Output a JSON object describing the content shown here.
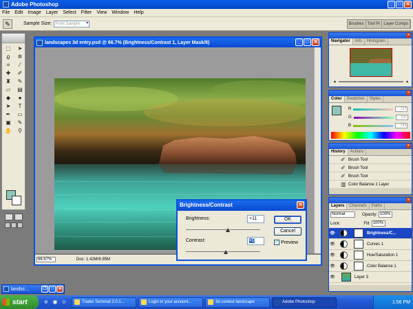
{
  "app": {
    "title": "Adobe Photoshop"
  },
  "menu": [
    "File",
    "Edit",
    "Image",
    "Layer",
    "Select",
    "Filter",
    "View",
    "Window",
    "Help"
  ],
  "options": {
    "sample_size_label": "Sample Size:",
    "sample_size_value": "Point Sample"
  },
  "palette_well": [
    "Brushes",
    "Tool Pr",
    "Layer Comps"
  ],
  "document": {
    "title": "landscapes 3d entry.psd @ 66.7% (Brightness/Contrast 1, Layer Mask/8)",
    "zoom": "66.67%",
    "doc_size": "Doc: 1.42M/6.95M"
  },
  "navigator": {
    "tabs": [
      "Navigator",
      "Info",
      "Histogram"
    ]
  },
  "color": {
    "tabs": [
      "Color",
      "Swatches",
      "Styles"
    ],
    "rows": [
      {
        "label": "R",
        "value": "137"
      },
      {
        "label": "G",
        "value": "192"
      },
      {
        "label": "B",
        "value": "184"
      }
    ],
    "fg_color": "#8fc6bb"
  },
  "history": {
    "tabs": [
      "History",
      "Actions"
    ],
    "items": [
      "Brush Tool",
      "Brush Tool",
      "Brush Tool",
      "Color Balance 1 Layer"
    ]
  },
  "layers": {
    "tabs": [
      "Layers",
      "Channels",
      "Paths"
    ],
    "blend_mode": "Normal",
    "opacity_label": "Opacity:",
    "opacity_value": "100%",
    "lock_label": "Lock:",
    "fill_label": "Fill:",
    "fill_value": "100%",
    "items": [
      {
        "name": "Brightness/C..."
      },
      {
        "name": "Curves 1"
      },
      {
        "name": "Hue/Saturation 1"
      },
      {
        "name": "Color Balance 1"
      },
      {
        "name": "Layer 3"
      }
    ]
  },
  "dialog": {
    "title": "Brightness/Contrast",
    "brightness_label": "Brightness:",
    "brightness_value": "+11",
    "contrast_label": "Contrast:",
    "contrast_value": "+0",
    "ok_label": "OK",
    "cancel_label": "Cancel",
    "preview_label": "Preview"
  },
  "minimized_doc": {
    "title": "landsc..."
  },
  "taskbar": {
    "start_label": "start",
    "tasks": [
      "Trader Terminal 2.0.1...",
      "Login to your account...",
      "3d contest landscape",
      "Adobe Photoshop"
    ],
    "clock": "1:56 PM"
  }
}
